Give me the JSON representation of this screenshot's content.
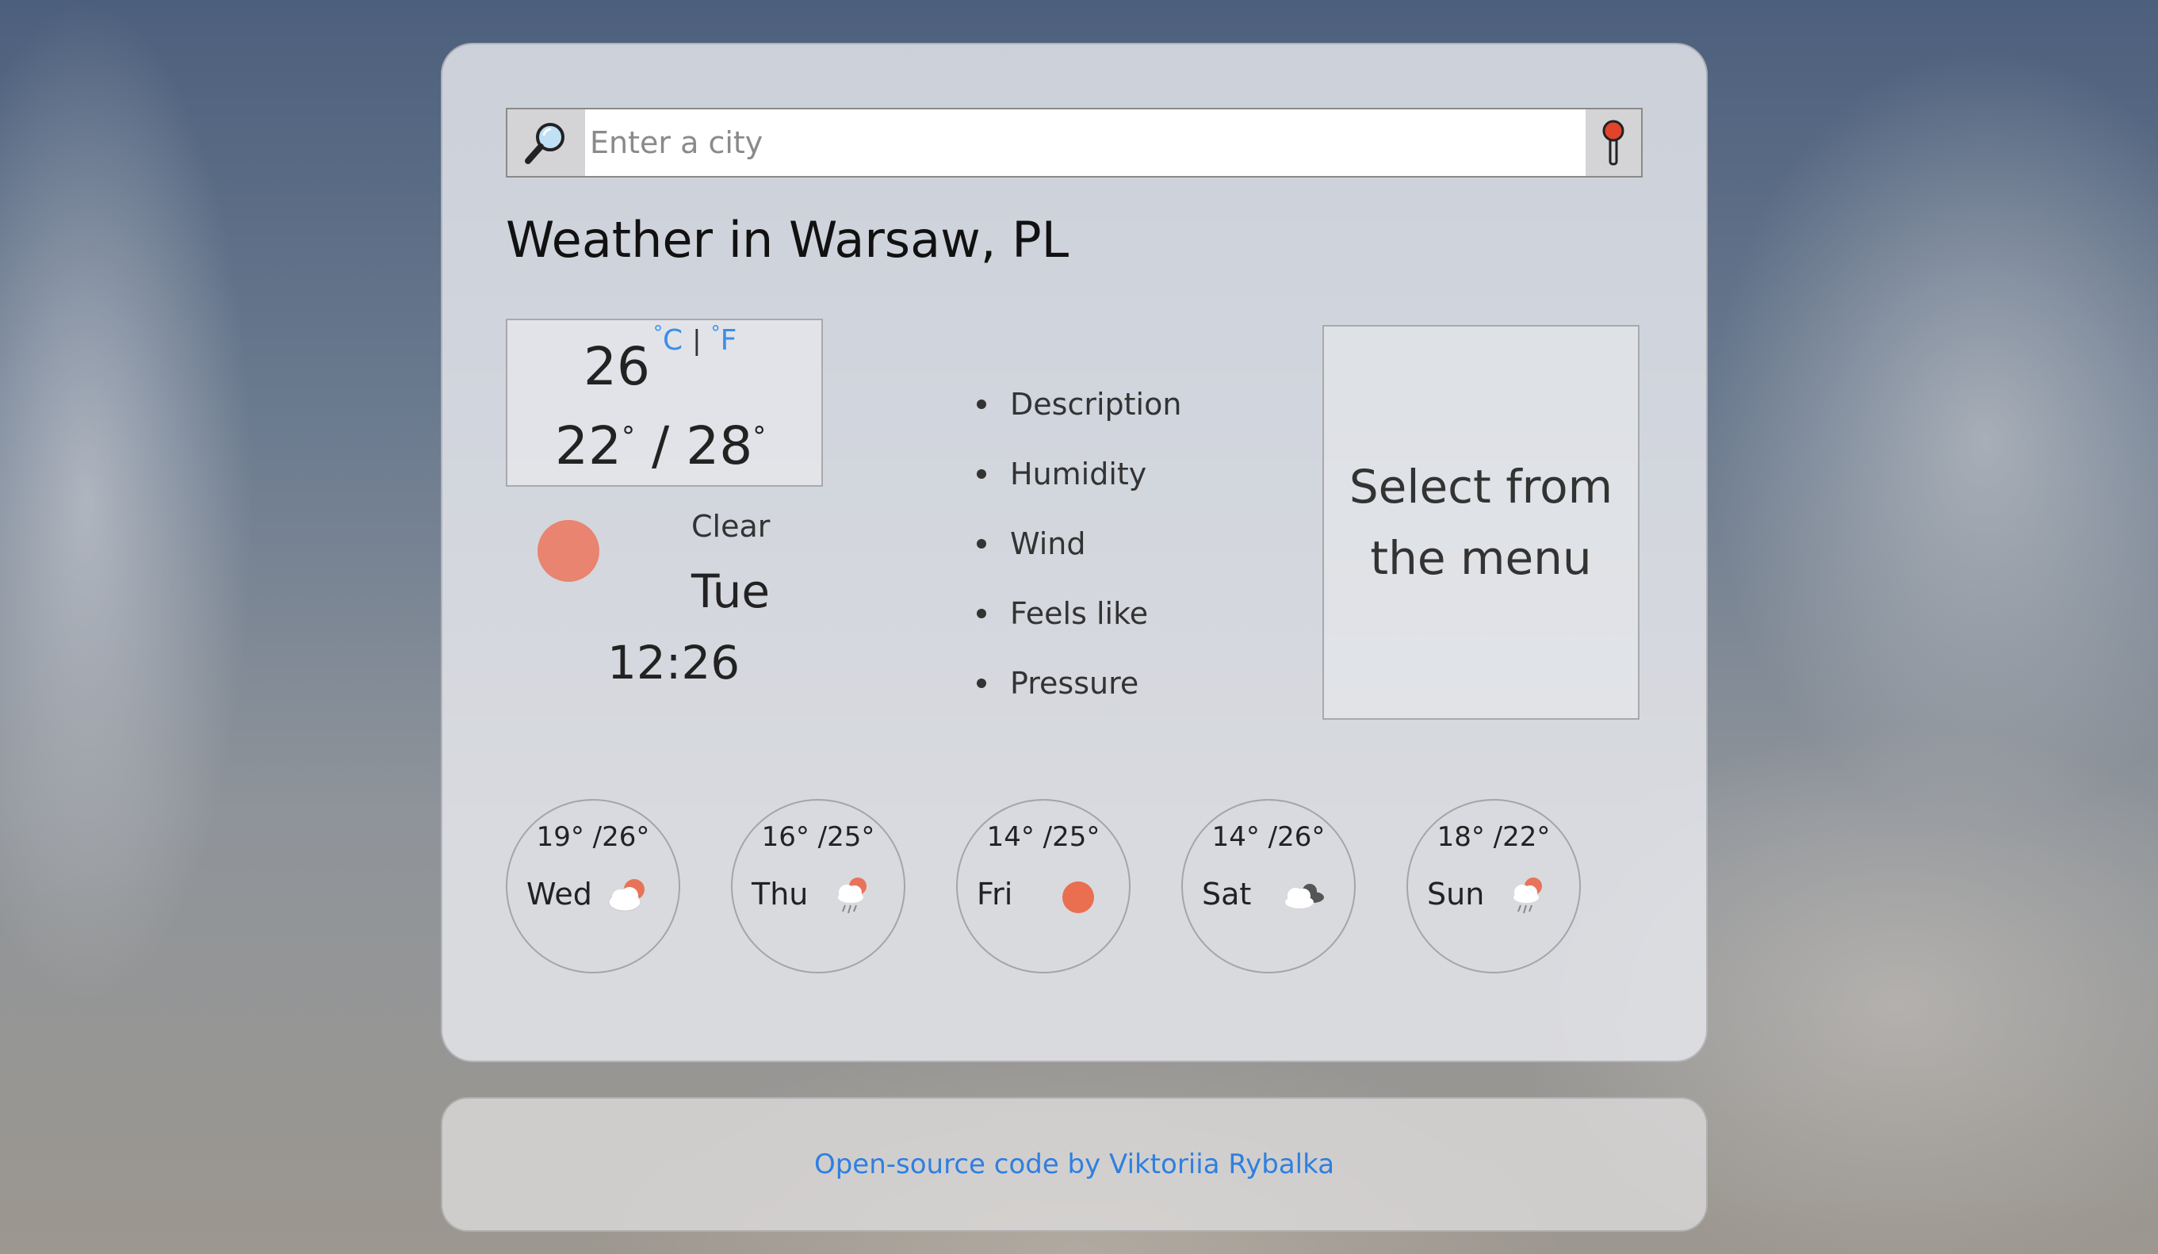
{
  "search": {
    "placeholder": "Enter a city",
    "value": ""
  },
  "title": "Weather in Warsaw, PL",
  "current": {
    "temp": "26",
    "unit_c": "C",
    "unit_sep": "|",
    "unit_f": "F",
    "min": "22",
    "max": "28",
    "range_sep": "/",
    "condition": "Clear",
    "day": "Tue",
    "time": "12:26",
    "icon": "sun-icon"
  },
  "details": [
    "Description",
    "Humidity",
    "Wind",
    "Feels like",
    "Pressure"
  ],
  "detail_panel": "Select from the menu",
  "forecast": [
    {
      "day": "Wed",
      "min": "19",
      "max": "26",
      "icon": "partly-cloudy-icon"
    },
    {
      "day": "Thu",
      "min": "16",
      "max": "25",
      "icon": "rain-sun-icon"
    },
    {
      "day": "Fri",
      "min": "14",
      "max": "25",
      "icon": "sun-icon"
    },
    {
      "day": "Sat",
      "min": "14",
      "max": "26",
      "icon": "cloudy-icon"
    },
    {
      "day": "Sun",
      "min": "18",
      "max": "22",
      "icon": "rain-sun-icon"
    }
  ],
  "footer": {
    "link_text": "Open-source code by Viktoriia Rybalka"
  },
  "colors": {
    "accent": "#3a8ee8",
    "sun": "#e8846f",
    "footer_link": "#2f7fe0"
  }
}
